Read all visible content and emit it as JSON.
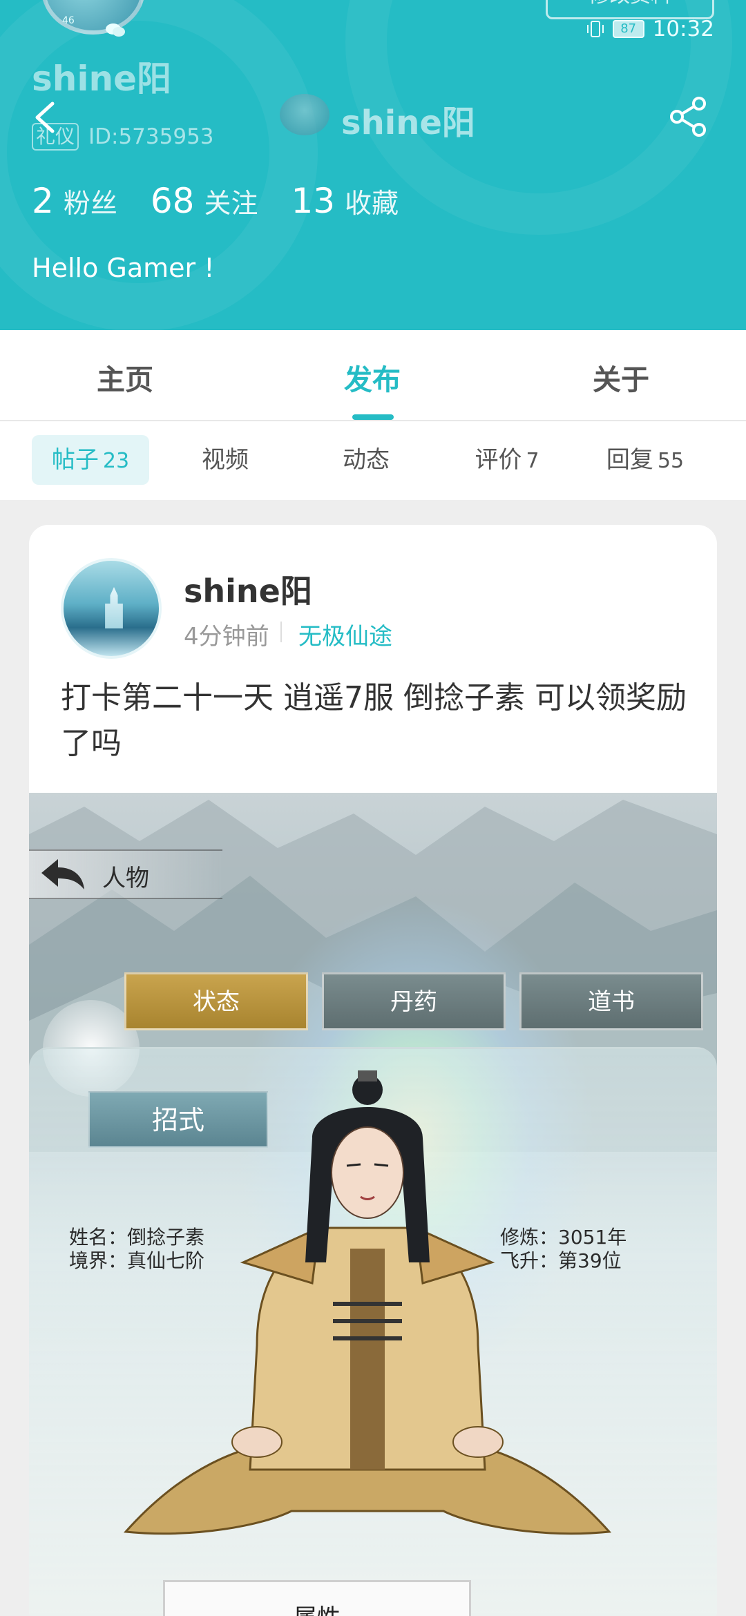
{
  "status_bar": {
    "network": "46",
    "battery": "87",
    "time": "10:32"
  },
  "profile": {
    "edit_label": "修改资料",
    "username": "shine阳",
    "tag": "礼仪",
    "id_label": "ID:5735953",
    "center_name": "shine阳",
    "stats": [
      {
        "num": "2",
        "label": "粉丝"
      },
      {
        "num": "68",
        "label": "关注"
      },
      {
        "num": "13",
        "label": "收藏"
      }
    ],
    "bio": "Hello Gamer !"
  },
  "tabs": [
    "主页",
    "发布",
    "关于"
  ],
  "active_tab": "发布",
  "subtabs": [
    {
      "label": "帖子",
      "count": "23"
    },
    {
      "label": "视频",
      "count": ""
    },
    {
      "label": "动态",
      "count": ""
    },
    {
      "label": "评价",
      "count": "7"
    },
    {
      "label": "回复",
      "count": "55"
    }
  ],
  "post": {
    "author": "shine阳",
    "time": "4分钟前",
    "game": "无极仙途",
    "text": "打卡第二十一天 逍遥7服 倒捻子素 可以领奖励了吗"
  },
  "game_screen": {
    "title": "人物",
    "buttons": [
      "状态",
      "丹药",
      "道书"
    ],
    "name_label": "姓名：倒捻子素",
    "realm_label": "境界：真仙七阶",
    "cultivation_label": "修炼：3051年",
    "ascend_label": "飞升：第39位",
    "skill_button": "招式",
    "bottom_tab": "属性"
  },
  "colors": {
    "accent": "#25bcc5",
    "header_bg": "#25bcc5",
    "gold_button": "#b8933e",
    "gray_button": "#6a7b7d"
  }
}
